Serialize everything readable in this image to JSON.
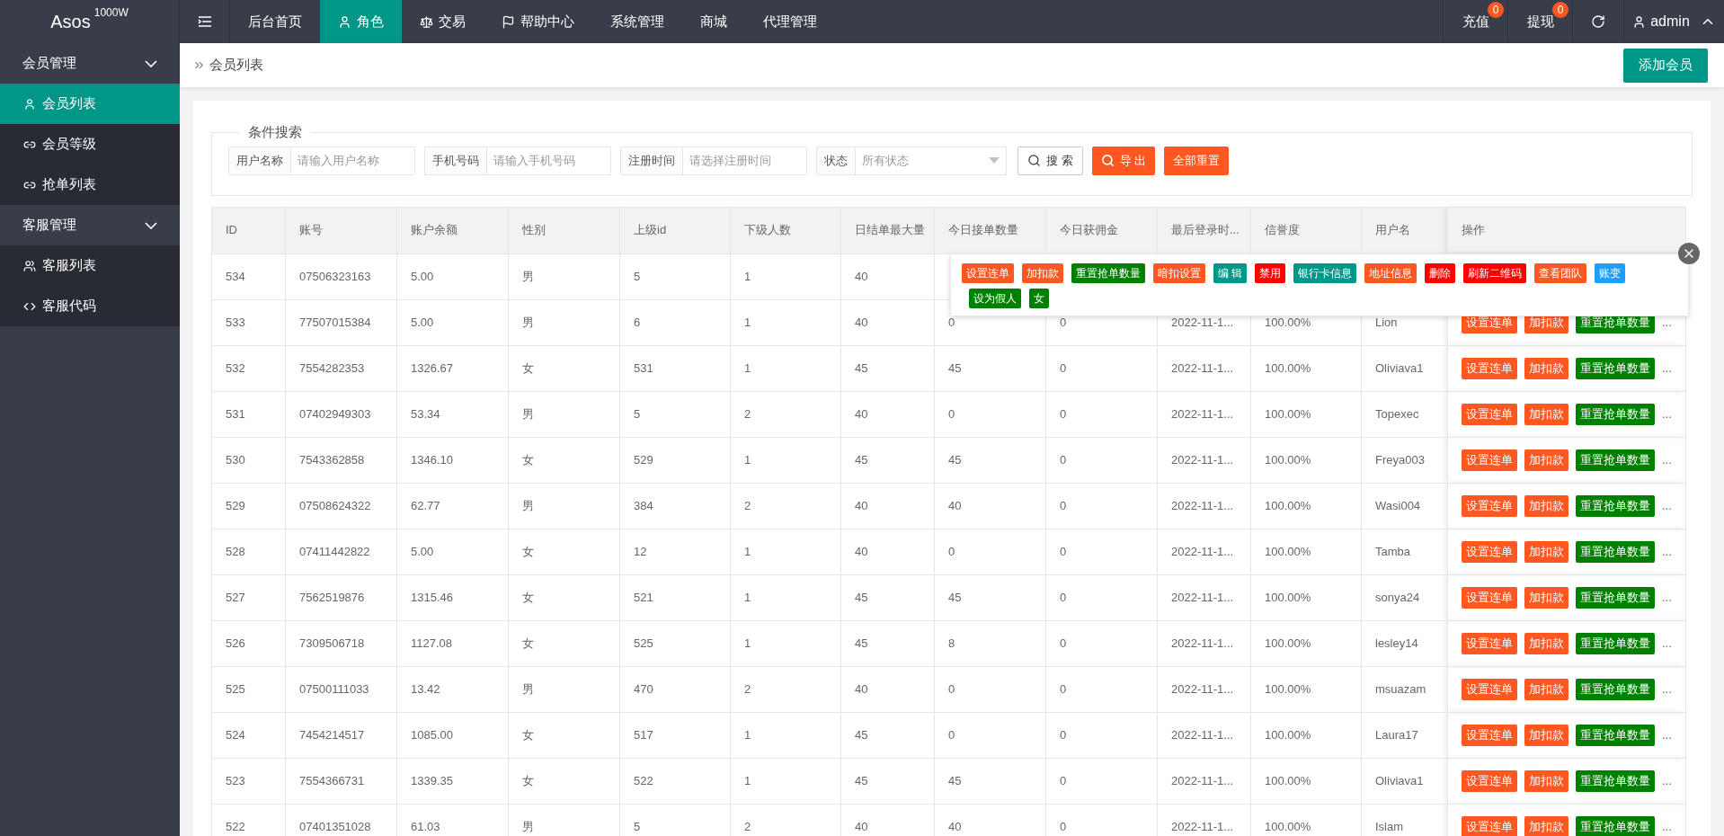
{
  "topbar": {
    "logo": "Asos",
    "logo_sup": "1000W",
    "nav": [
      {
        "label": "后台首页",
        "selected": false
      },
      {
        "label": "角色",
        "selected": true
      },
      {
        "label": "交易",
        "selected": false
      },
      {
        "label": "帮助中心",
        "selected": false
      },
      {
        "label": "系统管理",
        "selected": false
      },
      {
        "label": "商城",
        "selected": false
      },
      {
        "label": "代理管理",
        "selected": false
      }
    ],
    "right": [
      {
        "label": "充值",
        "badge": "0"
      },
      {
        "label": "提现",
        "badge": "0"
      }
    ],
    "user": "admin"
  },
  "sidebar": {
    "groups": [
      {
        "label": "会员管理",
        "expanded": true,
        "children": [
          {
            "label": "会员列表",
            "selected": true
          },
          {
            "label": "会员等级",
            "selected": false
          },
          {
            "label": "抢单列表",
            "selected": false
          }
        ]
      },
      {
        "label": "客服管理",
        "expanded": true,
        "children": [
          {
            "label": "客服列表",
            "selected": false
          },
          {
            "label": "客服代码",
            "selected": false
          }
        ]
      }
    ]
  },
  "breadcrumb": "会员列表",
  "add_button": "添加会员",
  "search": {
    "legend": "条件搜索",
    "fields": [
      {
        "kind": "input",
        "label": "用户名称",
        "placeholder": "请输入用户名称"
      },
      {
        "kind": "input",
        "label": "手机号码",
        "placeholder": "请输入手机号码"
      },
      {
        "kind": "input",
        "label": "注册时间",
        "placeholder": "请选择注册时间"
      },
      {
        "kind": "select",
        "label": "状态",
        "placeholder": "所有状态"
      }
    ],
    "buttons": [
      {
        "kind": "outline",
        "label": "搜 索"
      },
      {
        "kind": "export",
        "label": "导 出"
      },
      {
        "kind": "plain",
        "label": "全部重置"
      }
    ]
  },
  "table": {
    "columns": [
      "ID",
      "账号",
      "账户余额",
      "性别",
      "上级id",
      "下级人数",
      "日结单最大量",
      "今日接单数量",
      "今日获佣金",
      "最后登录时...",
      "信誉度",
      "用户名",
      "操作"
    ],
    "rows": [
      {
        "cells": [
          "534",
          "07506323163",
          "5.00",
          "男",
          "5",
          "1",
          "40"
        ],
        "actions": [],
        "more": ""
      },
      {
        "cells": [
          "533",
          "77507015384",
          "5.00",
          "男",
          "6",
          "1",
          "40",
          "0",
          "0",
          "2022-11-1...",
          "100.00%",
          "Lion"
        ],
        "actions": [
          {
            "label": "设置连单",
            "color": "#ff5722"
          },
          {
            "label": "加扣款",
            "color": "#ff5722"
          },
          {
            "label": "重置抢单数量",
            "color": "#008000"
          }
        ],
        "more": "..."
      },
      {
        "cells": [
          "532",
          "7554282353",
          "1326.67",
          "女",
          "531",
          "1",
          "45",
          "45",
          "0",
          "2022-11-1...",
          "100.00%",
          "Oliviava1"
        ],
        "actions": [
          {
            "label": "设置连单",
            "color": "#ff5722"
          },
          {
            "label": "加扣款",
            "color": "#ff5722"
          },
          {
            "label": "重置抢单数量",
            "color": "#008000"
          }
        ],
        "more": "..."
      },
      {
        "cells": [
          "531",
          "07402949303",
          "53.34",
          "男",
          "5",
          "2",
          "40",
          "0",
          "0",
          "2022-11-1...",
          "100.00%",
          "Topexec"
        ],
        "actions": [
          {
            "label": "设置连单",
            "color": "#ff5722"
          },
          {
            "label": "加扣款",
            "color": "#ff5722"
          },
          {
            "label": "重置抢单数量",
            "color": "#008000"
          }
        ],
        "more": "..."
      },
      {
        "cells": [
          "530",
          "7543362858",
          "1346.10",
          "女",
          "529",
          "1",
          "45",
          "45",
          "0",
          "2022-11-1...",
          "100.00%",
          "Freya003"
        ],
        "actions": [
          {
            "label": "设置连单",
            "color": "#ff5722"
          },
          {
            "label": "加扣款",
            "color": "#ff5722"
          },
          {
            "label": "重置抢单数量",
            "color": "#008000"
          }
        ],
        "more": "..."
      },
      {
        "cells": [
          "529",
          "07508624322",
          "62.77",
          "男",
          "384",
          "2",
          "40",
          "40",
          "0",
          "2022-11-1...",
          "100.00%",
          "Wasi004"
        ],
        "actions": [
          {
            "label": "设置连单",
            "color": "#ff5722"
          },
          {
            "label": "加扣款",
            "color": "#ff5722"
          },
          {
            "label": "重置抢单数量",
            "color": "#008000"
          }
        ],
        "more": "..."
      },
      {
        "cells": [
          "528",
          "07411442822",
          "5.00",
          "女",
          "12",
          "1",
          "40",
          "0",
          "0",
          "2022-11-1...",
          "100.00%",
          "Tamba"
        ],
        "actions": [
          {
            "label": "设置连单",
            "color": "#ff5722"
          },
          {
            "label": "加扣款",
            "color": "#ff5722"
          },
          {
            "label": "重置抢单数量",
            "color": "#008000"
          }
        ],
        "more": "..."
      },
      {
        "cells": [
          "527",
          "7562519876",
          "1315.46",
          "女",
          "521",
          "1",
          "45",
          "45",
          "0",
          "2022-11-1...",
          "100.00%",
          "sonya24"
        ],
        "actions": [
          {
            "label": "设置连单",
            "color": "#ff5722"
          },
          {
            "label": "加扣款",
            "color": "#ff5722"
          },
          {
            "label": "重置抢单数量",
            "color": "#008000"
          }
        ],
        "more": "..."
      },
      {
        "cells": [
          "526",
          "7309506718",
          "1127.08",
          "女",
          "525",
          "1",
          "45",
          "8",
          "0",
          "2022-11-1...",
          "100.00%",
          "lesley14"
        ],
        "actions": [
          {
            "label": "设置连单",
            "color": "#ff5722"
          },
          {
            "label": "加扣款",
            "color": "#ff5722"
          },
          {
            "label": "重置抢单数量",
            "color": "#008000"
          }
        ],
        "more": "..."
      },
      {
        "cells": [
          "525",
          "07500111033",
          "13.42",
          "男",
          "470",
          "2",
          "40",
          "0",
          "0",
          "2022-11-1...",
          "100.00%",
          "msuazam"
        ],
        "actions": [
          {
            "label": "设置连单",
            "color": "#ff5722"
          },
          {
            "label": "加扣款",
            "color": "#ff5722"
          },
          {
            "label": "重置抢单数量",
            "color": "#008000"
          }
        ],
        "more": "..."
      },
      {
        "cells": [
          "524",
          "7454214517",
          "1085.00",
          "女",
          "517",
          "1",
          "45",
          "0",
          "0",
          "2022-11-1...",
          "100.00%",
          "Laura17"
        ],
        "actions": [
          {
            "label": "设置连单",
            "color": "#ff5722"
          },
          {
            "label": "加扣款",
            "color": "#ff5722"
          },
          {
            "label": "重置抢单数量",
            "color": "#008000"
          }
        ],
        "more": "..."
      },
      {
        "cells": [
          "523",
          "7554366731",
          "1339.35",
          "女",
          "522",
          "1",
          "45",
          "45",
          "0",
          "2022-11-1...",
          "100.00%",
          "Oliviava1"
        ],
        "actions": [
          {
            "label": "设置连单",
            "color": "#ff5722"
          },
          {
            "label": "加扣款",
            "color": "#ff5722"
          },
          {
            "label": "重置抢单数量",
            "color": "#008000"
          }
        ],
        "more": "..."
      },
      {
        "cells": [
          "522",
          "07401351028",
          "61.03",
          "男",
          "5",
          "2",
          "40",
          "40",
          "0",
          "2022-11-1...",
          "100.00%",
          "Islam"
        ],
        "actions": [
          {
            "label": "设置连单",
            "color": "#ff5722"
          },
          {
            "label": "加扣款",
            "color": "#ff5722"
          },
          {
            "label": "重置抢单数量",
            "color": "#008000"
          }
        ],
        "more": "..."
      }
    ]
  },
  "popup": {
    "actions": [
      {
        "label": "设置连单",
        "color": "#ff5722"
      },
      {
        "label": "加扣款",
        "color": "#ff5722"
      },
      {
        "label": "重置抢单数量",
        "color": "#008000"
      },
      {
        "label": "暗扣设置",
        "color": "#ff5722"
      },
      {
        "label": "编 辑",
        "color": "#009688"
      },
      {
        "label": "禁用",
        "color": "#ff0000"
      },
      {
        "label": "银行卡信息",
        "color": "#009688"
      },
      {
        "label": "地址信息",
        "color": "#ff5722"
      },
      {
        "label": "删除",
        "color": "#ff0000"
      },
      {
        "label": "刷新二维码",
        "color": "#ff0000"
      },
      {
        "label": "查看团队",
        "color": "#ff5722"
      },
      {
        "label": "账变",
        "color": "#1e9fff"
      },
      {
        "label": "设为假人",
        "color": "#008000"
      },
      {
        "label": "女",
        "color": "#008000"
      }
    ]
  }
}
